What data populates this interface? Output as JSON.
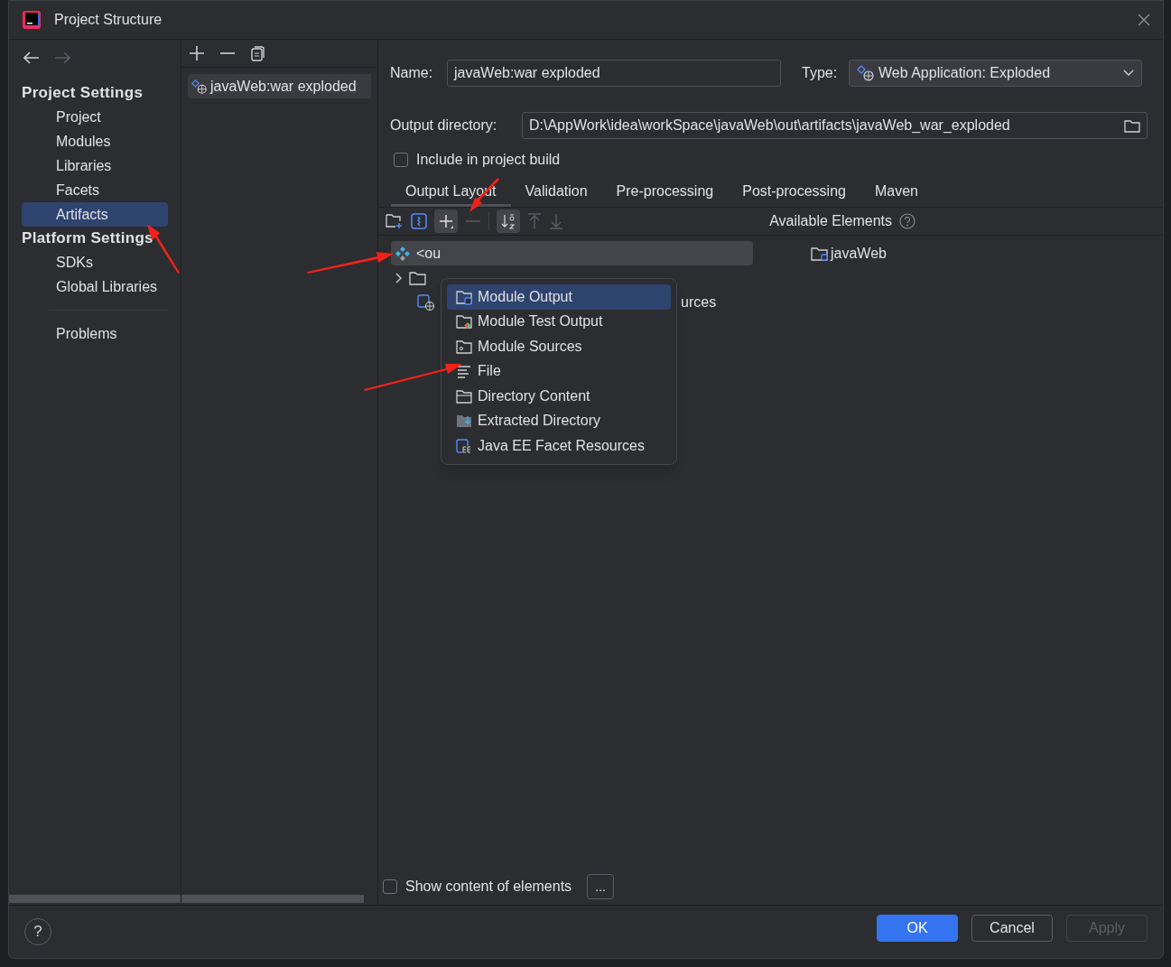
{
  "window": {
    "title": "Project Structure"
  },
  "sidebar": {
    "sections": [
      {
        "heading": "Project Settings",
        "items": [
          {
            "label": "Project",
            "selected": false
          },
          {
            "label": "Modules",
            "selected": false
          },
          {
            "label": "Libraries",
            "selected": false
          },
          {
            "label": "Facets",
            "selected": false
          },
          {
            "label": "Artifacts",
            "selected": true
          }
        ]
      },
      {
        "heading": "Platform Settings",
        "items": [
          {
            "label": "SDKs",
            "selected": false
          },
          {
            "label": "Global Libraries",
            "selected": false
          }
        ]
      },
      {
        "items": [
          {
            "label": "Problems",
            "selected": false
          }
        ]
      }
    ]
  },
  "artifacts": [
    {
      "label": "javaWeb:war exploded",
      "selected": true
    }
  ],
  "form": {
    "name_label": "Name:",
    "name": "javaWeb:war exploded",
    "type_label": "Type:",
    "type": "Web Application: Exploded",
    "output_label": "Output directory:",
    "output_directory": "D:\\AppWork\\idea\\workSpace\\javaWeb\\out\\artifacts\\javaWeb_war_exploded",
    "include_in_build": {
      "label": "Include in project build",
      "checked": false
    }
  },
  "tabs": [
    {
      "label": "Output Layout",
      "selected": true
    },
    {
      "label": "Validation",
      "selected": false
    },
    {
      "label": "Pre-processing",
      "selected": false
    },
    {
      "label": "Post-processing",
      "selected": false
    },
    {
      "label": "Maven",
      "selected": false
    }
  ],
  "available_label": "Available Elements",
  "output_tree": [
    {
      "kind": "root",
      "label": "<ou",
      "selected": true
    },
    {
      "kind": "folder",
      "expanded": false,
      "selected": false
    },
    {
      "kind": "facet",
      "label": "urces",
      "selected": false
    }
  ],
  "available_tree": [
    {
      "label": "javaWeb"
    }
  ],
  "add_menu": [
    {
      "kind": "module-output",
      "label": "Module Output",
      "selected": true
    },
    {
      "kind": "test-output",
      "label": "Module Test Output",
      "selected": false
    },
    {
      "kind": "sources",
      "label": "Module Sources",
      "selected": false
    },
    {
      "kind": "file",
      "label": "File",
      "selected": false
    },
    {
      "kind": "directory",
      "label": "Directory Content",
      "selected": false
    },
    {
      "kind": "extracted",
      "label": "Extracted Directory",
      "selected": false
    },
    {
      "kind": "javaee",
      "label": "Java EE Facet Resources",
      "selected": false
    }
  ],
  "show_content": {
    "label": "Show content of elements",
    "checked": false
  },
  "more_button": "...",
  "help_button": "?",
  "buttons": [
    {
      "label": "OK",
      "kind": "primary"
    },
    {
      "label": "Cancel",
      "kind": "secondary"
    },
    {
      "label": "Apply",
      "kind": "disabled"
    }
  ]
}
